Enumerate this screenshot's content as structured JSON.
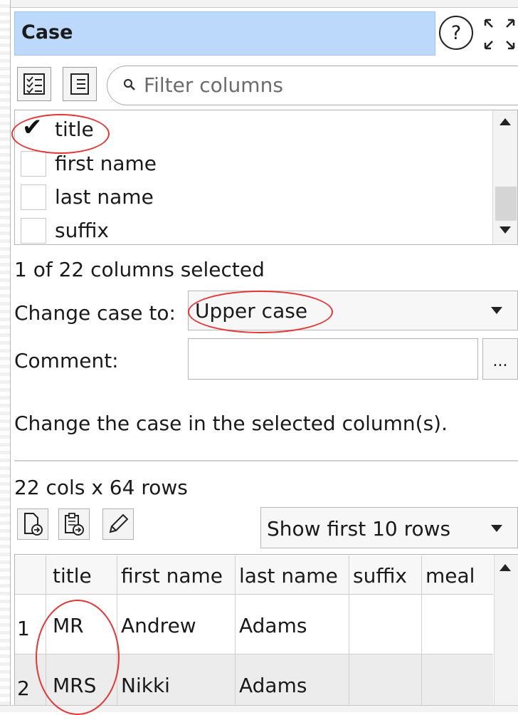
{
  "panel": {
    "title": "Case",
    "help_glyph": "?",
    "expand_icon": "expand-icon"
  },
  "toolbar": {
    "select_all_icon": "checklist-icon",
    "deselect_icon": "list-icon",
    "filter_placeholder": "Filter columns"
  },
  "columns": [
    {
      "name": "title",
      "checked": true
    },
    {
      "name": "first name",
      "checked": false
    },
    {
      "name": "last name",
      "checked": false
    },
    {
      "name": "suffix",
      "checked": false
    }
  ],
  "check_glyph": "✔",
  "selection_status": "1 of 22 columns selected",
  "change_case": {
    "label": "Change case to:",
    "value": "Upper case"
  },
  "comment": {
    "label": "Comment:",
    "value": "",
    "ellipsis": "..."
  },
  "description": "Change the case in the selected column(s).",
  "data_info": "22 cols x 64 rows",
  "rows_combo": "Show first 10 rows",
  "table": {
    "headers": [
      "",
      "title",
      "first name",
      "last name",
      "suffix",
      "meal"
    ],
    "rows": [
      [
        "1",
        "MR",
        "Andrew",
        "Adams",
        "",
        ""
      ],
      [
        "2",
        "MRS",
        "Nikki",
        "Adams",
        "",
        ""
      ]
    ]
  },
  "colors": {
    "title_bg": "#bcd9fb",
    "annotation": "#e53535",
    "alt_row": "#ececec"
  }
}
